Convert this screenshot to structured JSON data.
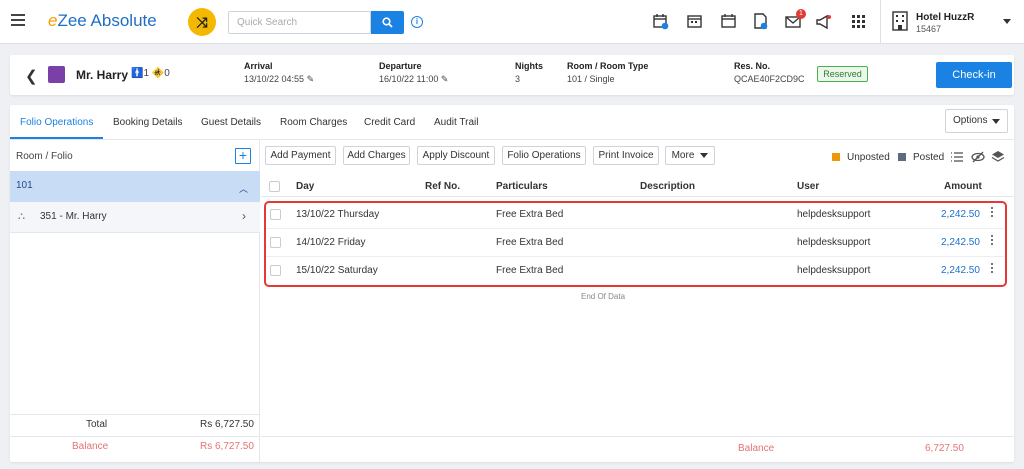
{
  "app": {
    "brand_e": "e",
    "brand_rest": "Zee Absolute",
    "search_placeholder": "Quick Search"
  },
  "hotel": {
    "name": "Hotel HuzzR",
    "id": "15467"
  },
  "notifications": {
    "count": "1"
  },
  "reservation": {
    "guest_name": "Mr. Harry",
    "adults": "1",
    "children": "0",
    "arrival_label": "Arrival",
    "arrival_value": "13/10/22 04:55",
    "departure_label": "Departure",
    "departure_value": "16/10/22 11:00",
    "nights_label": "Nights",
    "nights_value": "3",
    "room_label": "Room / Room Type",
    "room_value": "101 / Single",
    "resno_label": "Res. No.",
    "resno_value": "QCAE40F2CD9C",
    "status": "Reserved",
    "checkin_label": "Check-in"
  },
  "tabs": [
    "Folio Operations",
    "Booking Details",
    "Guest Details",
    "Room Charges",
    "Credit Card",
    "Audit Trail"
  ],
  "options_label": "Options",
  "left": {
    "header": "Room / Folio",
    "room": "101",
    "folio": "351 - Mr. Harry",
    "total_label": "Total",
    "total_value": "Rs 6,727.50",
    "balance_label": "Balance",
    "balance_value": "Rs 6,727.50"
  },
  "actions": [
    "Add Payment",
    "Add Charges",
    "Apply Discount",
    "Folio Operations",
    "Print Invoice",
    "More"
  ],
  "legend": {
    "unposted": "Unposted",
    "posted": "Posted",
    "unposted_color": "#f0960a",
    "posted_color": "#5b6b82"
  },
  "columns": [
    "Day",
    "Ref No.",
    "Particulars",
    "Description",
    "User",
    "Amount"
  ],
  "rows": [
    {
      "day": "13/10/22 Thursday",
      "ref": "",
      "particulars": "Free Extra Bed",
      "description": "",
      "user": "helpdesksupport",
      "amount": "2,242.50"
    },
    {
      "day": "14/10/22 Friday",
      "ref": "",
      "particulars": "Free Extra Bed",
      "description": "",
      "user": "helpdesksupport",
      "amount": "2,242.50"
    },
    {
      "day": "15/10/22 Saturday",
      "ref": "",
      "particulars": "Free Extra Bed",
      "description": "",
      "user": "helpdesksupport",
      "amount": "2,242.50"
    }
  ],
  "end_of_data": "End Of Data",
  "footer": {
    "balance_label": "Balance",
    "balance_value": "6,727.50"
  }
}
